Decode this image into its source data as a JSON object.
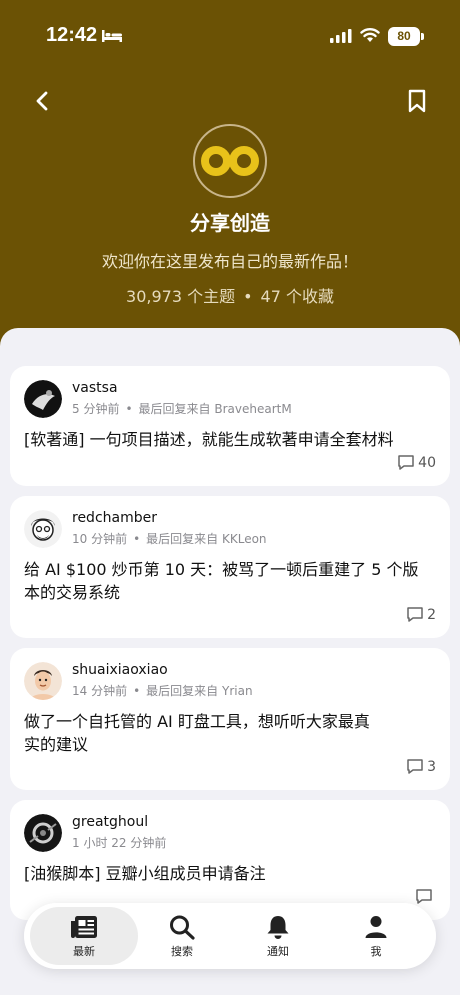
{
  "status_bar": {
    "time": "12:42",
    "battery": "80"
  },
  "header": {
    "title": "分享创造",
    "description": "欢迎你在这里发布自己的最新作品！",
    "topics_count": "30,973 个主题",
    "stats_separator": "•",
    "favorites_count": "47 个收藏",
    "colors": {
      "background": "#6b5205",
      "logo": "#e8c21a"
    }
  },
  "topics": [
    {
      "username": "vastsa",
      "time": "5 分钟前",
      "separator": "•",
      "last_reply": "最后回复来自 BraveheartM",
      "title": "[软著通] 一句项目描述，就能生成软著申请全套材料",
      "replies": "40"
    },
    {
      "username": "redchamber",
      "time": "10 分钟前",
      "separator": "•",
      "last_reply": "最后回复来自 KKLeon",
      "title": "给 AI $100 炒币第 10 天：被骂了一顿后重建了 5 个版本的交易系统",
      "replies": "2"
    },
    {
      "username": "shuaixiaoxiao",
      "time": "14 分钟前",
      "separator": "•",
      "last_reply": "最后回复来自 Yrian",
      "title": "做了一个自托管的 AI 盯盘工具，想听听大家最真实的建议",
      "replies": "3"
    },
    {
      "username": "greatghoul",
      "time": "1 小时 22 分钟前",
      "title": "[油猴脚本] 豆瓣小组成员申请备注",
      "replies": ""
    }
  ],
  "tabbar": {
    "items": [
      {
        "label": "最新",
        "icon": "news-icon",
        "active": true
      },
      {
        "label": "搜索",
        "icon": "search-icon"
      },
      {
        "label": "通知",
        "icon": "bell-icon"
      },
      {
        "label": "我",
        "icon": "person-icon"
      }
    ]
  }
}
